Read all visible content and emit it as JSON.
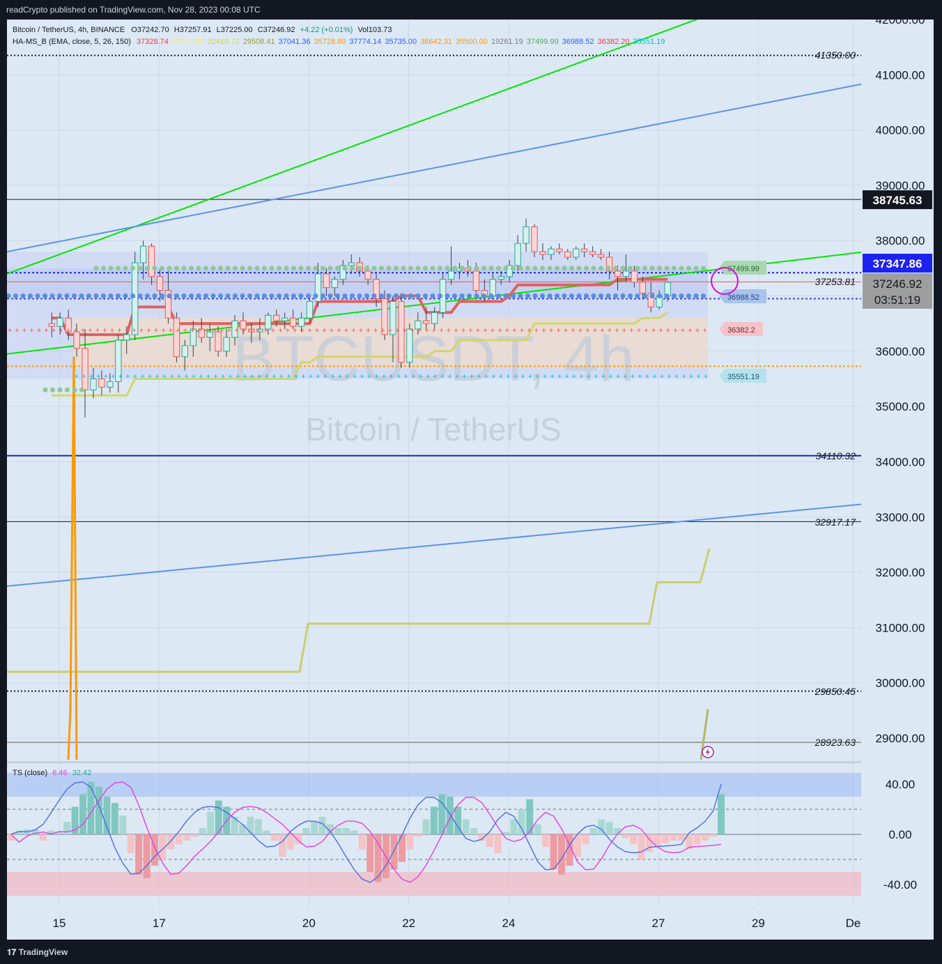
{
  "header": {
    "published": "readCrypto published on TradingView.com, Nov 28, 2023 00:08 UTC"
  },
  "footer": {
    "brand": "TradingView"
  },
  "legend": {
    "symbol": "Bitcoin / TetherUS, 4h, BINANCE",
    "open": "O37242.70",
    "high": "H37257.91",
    "low": "L37225.00",
    "close": "C37246.92",
    "change": "+4.22 (+0.01%)",
    "volume": "Vol103.73",
    "indicator": "HA-MS_B (EMA, close, 5, 26, 150)",
    "indicator_values": [
      {
        "text": "37328.74",
        "color": "#f23645"
      },
      {
        "text": "36712.99",
        "color": "#ffeb3b"
      },
      {
        "text": "32418.72",
        "color": "#cddc39"
      },
      {
        "text": "29508.41",
        "color": "#9e9d24"
      },
      {
        "text": "37041.36",
        "color": "#2962ff"
      },
      {
        "text": "35728.80",
        "color": "#ff9800"
      },
      {
        "text": "37774.14",
        "color": "#2962ff"
      },
      {
        "text": "35735.00",
        "color": "#2962ff"
      },
      {
        "text": "36642.31",
        "color": "#ff9800"
      },
      {
        "text": "35500.00",
        "color": "#ff9800"
      },
      {
        "text": "19261.19",
        "color": "#787b86"
      },
      {
        "text": "37499.99",
        "color": "#4caf50"
      },
      {
        "text": "36988.52",
        "color": "#2962ff"
      },
      {
        "text": "36382.20",
        "color": "#f23645"
      },
      {
        "text": "35551.19",
        "color": "#00bcd4"
      }
    ],
    "ts_label": "TS (close)",
    "ts_value1": "6.46",
    "ts_value2": "32.42"
  },
  "watermark": {
    "ticker": "BTCUSDT, 4h",
    "name": "Bitcoin / TetherUS"
  },
  "level_labels": {
    "l41350": "41350.00",
    "l37253": "37253.81",
    "l34110": "34110.32",
    "l32917": "32917.17",
    "l29850": "29850.45",
    "l28923": "28923.63"
  },
  "tags": {
    "t37499": "37499.99",
    "t36988": "36988.52",
    "t36382": "36382.2",
    "t35551": "35551.19"
  },
  "price_badges": {
    "b38745": "38745.63",
    "b37347": "37347.86",
    "b37246": "37246.92",
    "countdown": "03:51:19"
  },
  "colors": {
    "background": "#dde8f5",
    "frame": "#131722",
    "green_line": "#00e600",
    "blue_line": "#5b93e6",
    "candle_up": "#26a69a",
    "candle_down": "#ef5350",
    "red_line": "#e06060",
    "yellow_line": "#d4d46a",
    "orange_line": "#ff9800",
    "ts_blue": "#4a6fe0",
    "ts_magenta": "#e040e0"
  },
  "chart_data": [
    {
      "type": "candlestick",
      "title": "Bitcoin / TetherUS, 4h, BINANCE",
      "ylim": [
        28500,
        42000
      ],
      "y_ticks": [
        "29000.00",
        "30000.00",
        "31000.00",
        "32000.00",
        "33000.00",
        "34000.00",
        "35000.00",
        "36000.00",
        "37000.00",
        "38000.00",
        "39000.00",
        "40000.00",
        "41000.00",
        "42000.00"
      ],
      "x_ticks": [
        {
          "label": "15",
          "day": 15
        },
        {
          "label": "17",
          "day": 17
        },
        {
          "label": "20",
          "day": 20
        },
        {
          "label": "22",
          "day": 22
        },
        {
          "label": "24",
          "day": 24
        },
        {
          "label": "27",
          "day": 27
        },
        {
          "label": "29",
          "day": 29
        },
        {
          "label": "De",
          "day": 30.9
        }
      ],
      "horizontal_levels": [
        41350.0,
        38745.63,
        37253.81,
        34110.32,
        32917.17,
        29850.45,
        28923.63
      ],
      "candles": [
        {
          "o": 36500,
          "h": 36700,
          "l": 36250,
          "c": 36450
        },
        {
          "o": 36450,
          "h": 36700,
          "l": 36300,
          "c": 36600
        },
        {
          "o": 36600,
          "h": 36750,
          "l": 36200,
          "c": 36350
        },
        {
          "o": 36350,
          "h": 36500,
          "l": 35900,
          "c": 36050
        },
        {
          "o": 36050,
          "h": 36400,
          "l": 34800,
          "c": 35300
        },
        {
          "o": 35300,
          "h": 35700,
          "l": 35150,
          "c": 35500
        },
        {
          "o": 35500,
          "h": 35650,
          "l": 35200,
          "c": 35350
        },
        {
          "o": 35350,
          "h": 35600,
          "l": 35250,
          "c": 35450
        },
        {
          "o": 35450,
          "h": 36300,
          "l": 35250,
          "c": 36200
        },
        {
          "o": 36200,
          "h": 36450,
          "l": 35950,
          "c": 36300
        },
        {
          "o": 36300,
          "h": 37800,
          "l": 36200,
          "c": 37600
        },
        {
          "o": 37600,
          "h": 38000,
          "l": 37300,
          "c": 37900
        },
        {
          "o": 37900,
          "h": 37950,
          "l": 37200,
          "c": 37350
        },
        {
          "o": 37350,
          "h": 37500,
          "l": 36900,
          "c": 37100
        },
        {
          "o": 37100,
          "h": 37450,
          "l": 36500,
          "c": 36600
        },
        {
          "o": 36600,
          "h": 36700,
          "l": 35800,
          "c": 35900
        },
        {
          "o": 35900,
          "h": 36200,
          "l": 35650,
          "c": 36100
        },
        {
          "o": 36100,
          "h": 36550,
          "l": 35900,
          "c": 36400
        },
        {
          "o": 36400,
          "h": 36600,
          "l": 36150,
          "c": 36250
        },
        {
          "o": 36250,
          "h": 36500,
          "l": 36000,
          "c": 36350
        },
        {
          "o": 36350,
          "h": 36450,
          "l": 35900,
          "c": 36000
        },
        {
          "o": 36000,
          "h": 36400,
          "l": 35900,
          "c": 36250
        },
        {
          "o": 36250,
          "h": 36650,
          "l": 36100,
          "c": 36550
        },
        {
          "o": 36550,
          "h": 36700,
          "l": 36300,
          "c": 36400
        },
        {
          "o": 36400,
          "h": 36500,
          "l": 36150,
          "c": 36350
        },
        {
          "o": 36350,
          "h": 36600,
          "l": 36200,
          "c": 36400
        },
        {
          "o": 36400,
          "h": 36700,
          "l": 36300,
          "c": 36650
        },
        {
          "o": 36650,
          "h": 36750,
          "l": 36450,
          "c": 36550
        },
        {
          "o": 36550,
          "h": 36700,
          "l": 36400,
          "c": 36600
        },
        {
          "o": 36600,
          "h": 36750,
          "l": 36400,
          "c": 36450
        },
        {
          "o": 36450,
          "h": 36700,
          "l": 36350,
          "c": 36600
        },
        {
          "o": 36600,
          "h": 37000,
          "l": 36500,
          "c": 36900
        },
        {
          "o": 36900,
          "h": 37600,
          "l": 36800,
          "c": 37400
        },
        {
          "o": 37400,
          "h": 37500,
          "l": 37000,
          "c": 37150
        },
        {
          "o": 37150,
          "h": 37350,
          "l": 37000,
          "c": 37300
        },
        {
          "o": 37300,
          "h": 37650,
          "l": 37200,
          "c": 37550
        },
        {
          "o": 37550,
          "h": 37750,
          "l": 37400,
          "c": 37600
        },
        {
          "o": 37600,
          "h": 37700,
          "l": 37350,
          "c": 37450
        },
        {
          "o": 37450,
          "h": 37550,
          "l": 37200,
          "c": 37300
        },
        {
          "o": 37300,
          "h": 37400,
          "l": 36800,
          "c": 36950
        },
        {
          "o": 36950,
          "h": 37100,
          "l": 36200,
          "c": 36300
        },
        {
          "o": 36300,
          "h": 37000,
          "l": 35800,
          "c": 36900
        },
        {
          "o": 36900,
          "h": 37050,
          "l": 35700,
          "c": 35800
        },
        {
          "o": 35800,
          "h": 36500,
          "l": 35700,
          "c": 36400
        },
        {
          "o": 36400,
          "h": 36700,
          "l": 36300,
          "c": 36550
        },
        {
          "o": 36550,
          "h": 36800,
          "l": 36400,
          "c": 36500
        },
        {
          "o": 36500,
          "h": 36800,
          "l": 36400,
          "c": 36700
        },
        {
          "o": 36700,
          "h": 37400,
          "l": 36600,
          "c": 37300
        },
        {
          "o": 37300,
          "h": 37900,
          "l": 37200,
          "c": 37450
        },
        {
          "o": 37450,
          "h": 37600,
          "l": 37300,
          "c": 37500
        },
        {
          "o": 37500,
          "h": 37650,
          "l": 37350,
          "c": 37450
        },
        {
          "o": 37450,
          "h": 37600,
          "l": 37050,
          "c": 37100
        },
        {
          "o": 37100,
          "h": 37300,
          "l": 36900,
          "c": 37000
        },
        {
          "o": 37000,
          "h": 37400,
          "l": 36950,
          "c": 37300
        },
        {
          "o": 37300,
          "h": 37450,
          "l": 37200,
          "c": 37350
        },
        {
          "o": 37350,
          "h": 37650,
          "l": 37250,
          "c": 37550
        },
        {
          "o": 37550,
          "h": 38100,
          "l": 37450,
          "c": 37950
        },
        {
          "o": 37950,
          "h": 38400,
          "l": 37800,
          "c": 38250
        },
        {
          "o": 38250,
          "h": 38300,
          "l": 37700,
          "c": 37800
        },
        {
          "o": 37800,
          "h": 37950,
          "l": 37650,
          "c": 37750
        },
        {
          "o": 37750,
          "h": 37900,
          "l": 37650,
          "c": 37850
        },
        {
          "o": 37850,
          "h": 37950,
          "l": 37750,
          "c": 37800
        },
        {
          "o": 37800,
          "h": 37850,
          "l": 37650,
          "c": 37700
        },
        {
          "o": 37700,
          "h": 37900,
          "l": 37650,
          "c": 37850
        },
        {
          "o": 37850,
          "h": 37950,
          "l": 37700,
          "c": 37800
        },
        {
          "o": 37800,
          "h": 37900,
          "l": 37700,
          "c": 37750
        },
        {
          "o": 37750,
          "h": 37850,
          "l": 37650,
          "c": 37700
        },
        {
          "o": 37700,
          "h": 37800,
          "l": 37300,
          "c": 37450
        },
        {
          "o": 37450,
          "h": 37550,
          "l": 37100,
          "c": 37350
        },
        {
          "o": 37350,
          "h": 37750,
          "l": 37250,
          "c": 37450
        },
        {
          "o": 37450,
          "h": 37550,
          "l": 37150,
          "c": 37250
        },
        {
          "o": 37250,
          "h": 37350,
          "l": 36950,
          "c": 37050
        },
        {
          "o": 37050,
          "h": 37250,
          "l": 36700,
          "c": 36800
        },
        {
          "o": 36800,
          "h": 37100,
          "l": 36750,
          "c": 37000
        },
        {
          "o": 37000,
          "h": 37260,
          "l": 36900,
          "c": 37247
        }
      ],
      "series": [
        {
          "values_note": "red_line",
          "values": [
            36600,
            36600,
            36300,
            36300,
            36300,
            36300,
            36300,
            36300,
            36300,
            36300,
            36800,
            36800,
            36800,
            36800,
            36800,
            36500,
            36500,
            36500,
            36500,
            36500,
            36500,
            36500,
            36500,
            36500,
            36500,
            36500,
            36500,
            36500,
            36500,
            36500,
            36500,
            36500,
            36900,
            36900,
            36900,
            36900,
            36900,
            36900,
            36900,
            36900,
            36900,
            36900,
            37000,
            37000,
            37000,
            36700,
            36700,
            36700,
            36700,
            36900,
            36900,
            36900,
            36900,
            36900,
            36900,
            37000,
            37200,
            37200,
            37200,
            37200,
            37200,
            37200,
            37200,
            37200,
            37200,
            37200,
            37200,
            37200,
            37300,
            37300,
            37300,
            37300,
            37300,
            37300,
            37300
          ]
        },
        {
          "values_note": "yellow_line",
          "values": [
            35200,
            35200,
            35200,
            35200,
            35200,
            35200,
            35200,
            35200,
            35200,
            35200,
            35500,
            35500,
            35500,
            35500,
            35500,
            35500,
            35500,
            35500,
            35500,
            35500,
            35500,
            35500,
            35500,
            35500,
            35500,
            35500,
            35500,
            35500,
            35500,
            35500,
            35800,
            35800,
            35900,
            35900,
            35900,
            35900,
            35900,
            35900,
            35900,
            35900,
            35900,
            35900,
            35900,
            35900,
            35900,
            35900,
            36000,
            36000,
            36000,
            36200,
            36200,
            36200,
            36200,
            36200,
            36200,
            36200,
            36200,
            36200,
            36500,
            36500,
            36500,
            36500,
            36500,
            36500,
            36500,
            36500,
            36500,
            36500,
            36500,
            36500,
            36500,
            36600,
            36600,
            36600,
            36700
          ]
        }
      ]
    },
    {
      "type": "bar",
      "title": "TS (close)",
      "ylim": [
        -55,
        55
      ],
      "y_ticks": [
        "40.00",
        "0.00",
        "-40.00"
      ],
      "values": [
        -5,
        3,
        4,
        4,
        -5,
        3,
        2,
        10,
        22,
        32,
        42,
        38,
        30,
        25,
        15,
        -15,
        -32,
        -35,
        -25,
        -20,
        -12,
        -8,
        -5,
        -2,
        5,
        18,
        27,
        22,
        14,
        8,
        14,
        12,
        3,
        -5,
        -18,
        -12,
        -8,
        5,
        10,
        14,
        8,
        5,
        5,
        3,
        -12,
        -30,
        -38,
        -35,
        -28,
        -22,
        -12,
        -2,
        12,
        22,
        32,
        30,
        22,
        12,
        5,
        -5,
        -10,
        -15,
        2,
        12,
        20,
        28,
        8,
        -10,
        -28,
        -32,
        -25,
        -18,
        -8,
        5,
        12,
        10,
        5,
        -3,
        -8,
        -20,
        -14,
        -10,
        -7,
        -5,
        -5,
        -12,
        -8,
        -5,
        -2,
        32
      ],
      "series": [
        {
          "name": "6.46",
          "color": "#e040e0"
        },
        {
          "name": "32.42",
          "color": "#26a69a"
        }
      ]
    }
  ]
}
